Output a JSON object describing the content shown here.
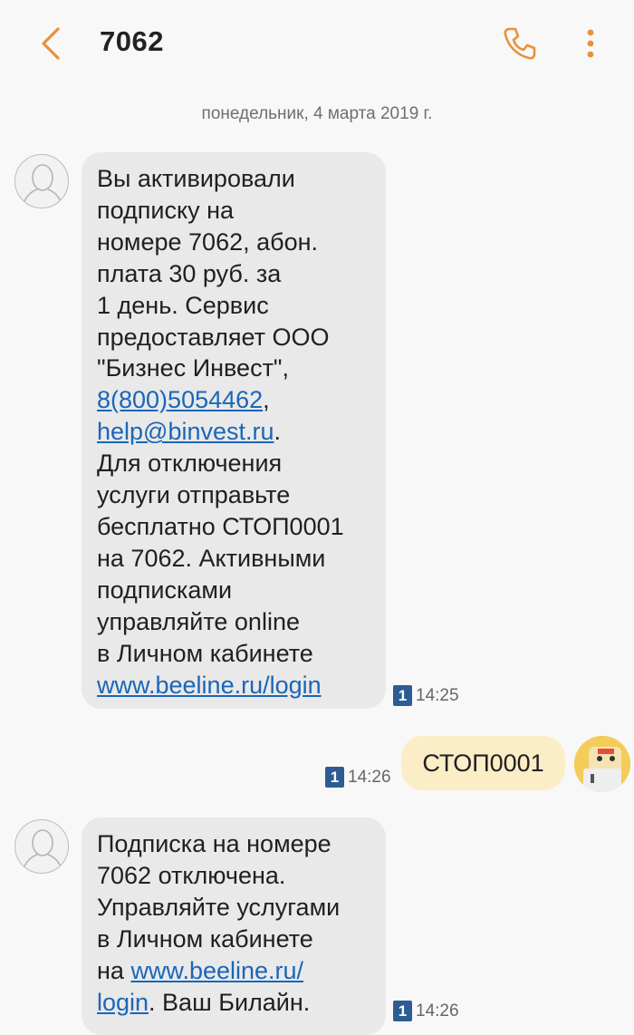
{
  "header": {
    "title": "7062",
    "back_icon": "chevron-left-icon",
    "call_icon": "phone-icon",
    "more_icon": "more-vertical-icon",
    "accent_color": "#e8913a"
  },
  "date_separator": "понедельник, 4 марта 2019 г.",
  "messages": [
    {
      "direction": "incoming",
      "lines": [
        "Вы активировали",
        "подписку на",
        "номере 7062, абон.",
        "плата 30 руб. за",
        "1 день. Сервис",
        "предоставляет ООО",
        "\"Бизнес Инвест\",",
        "8(800)5054462",
        ",",
        "help@binvest.ru",
        ".",
        "Для отключения",
        "услуги отправьте",
        "бесплатно СТОП0001",
        "на 7062. Активными",
        "подписками",
        "управляйте online",
        "в Личном кабинете",
        "www.beeline.ru/login"
      ],
      "sim": "1",
      "time": "14:25"
    },
    {
      "direction": "outgoing",
      "text": "СТОП0001",
      "sim": "1",
      "time": "14:26"
    },
    {
      "direction": "incoming",
      "lines": [
        "Подписка на номере",
        "7062 отключена.",
        "Управляйте услугами",
        "в Личном кабинете",
        "на ",
        "www.beeline.ru/",
        "login",
        ". Ваш Билайн."
      ],
      "sim": "1",
      "time": "14:26"
    }
  ],
  "colors": {
    "incoming_bubble": "#e9e9e9",
    "outgoing_bubble": "#fbedc6",
    "link": "#1a66b8",
    "sim_badge": "#2d5c93"
  }
}
